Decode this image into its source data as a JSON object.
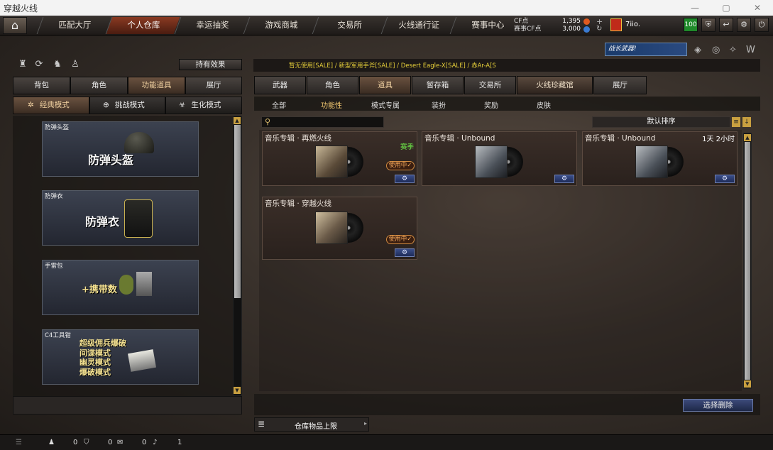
{
  "window": {
    "title": "穿越火线",
    "minimize": "—",
    "maximize": "▢",
    "close": "✕"
  },
  "nav": {
    "home_icon": "home-icon",
    "tabs": [
      "匹配大厅",
      "个人仓库",
      "幸运抽奖",
      "游戏商城",
      "交易所",
      "火线通行证",
      "赛事中心"
    ],
    "active_tab": "个人仓库",
    "cf_label": "CF点",
    "cf_value": "1,395",
    "cf_points_label": "赛事CF点",
    "cf_points_value": "3,000",
    "player_name": "7iio.",
    "level_badge": "100"
  },
  "left": {
    "effect_button": "持有效果",
    "tabs": [
      "背包",
      "角色",
      "功能道具",
      "展厅"
    ],
    "active_tab": "功能道具",
    "modes": [
      "经典模式",
      "挑战模式",
      "生化模式"
    ],
    "active_mode": "经典模式",
    "slots": [
      {
        "label": "防弹头盔",
        "title": "防弹头盔"
      },
      {
        "label": "防弹衣",
        "title": "防弹衣"
      },
      {
        "label": "手雷包",
        "title": "+携带数"
      },
      {
        "label": "C4工具钳",
        "lines": [
          "超级佣兵爆破",
          "间谍模式",
          "幽灵模式",
          "爆破模式"
        ]
      }
    ]
  },
  "right": {
    "banner_text": "战长武器!",
    "breadcrumb": "暂无使用[SALE] / 新型军用手斧[SALE] / Desert Eagle-X[SALE] / 赤Ar-A[S",
    "tabs": [
      "武器",
      "角色",
      "道具",
      "暂存箱",
      "交易所",
      "火线珍藏馆",
      "展厅"
    ],
    "active_tab": "火线珍藏馆",
    "selected_tab": "道具",
    "subtabs": [
      "全部",
      "功能性",
      "模式专属",
      "装扮",
      "奖励",
      "皮肤"
    ],
    "active_subtab": "功能性",
    "search_placeholder": "",
    "sort_label": "默认排序",
    "items": [
      {
        "title": "音乐专辑 · 再燃火线",
        "season": "赛季",
        "in_use": "使用中✓",
        "time": ""
      },
      {
        "title": "音乐专辑 · Unbound",
        "season": "",
        "in_use": "",
        "time": ""
      },
      {
        "title": "音乐专辑 · Unbound",
        "season": "",
        "in_use": "",
        "time": "1天 2小时"
      },
      {
        "title": "音乐专辑 · 穿越火线",
        "season": "",
        "in_use": "使用中✓",
        "time": ""
      }
    ],
    "batch_delete": "选择删除",
    "capacity_label": "仓库物品上限"
  },
  "bottom": {
    "counts": [
      "0",
      "0",
      "0",
      "1"
    ]
  }
}
